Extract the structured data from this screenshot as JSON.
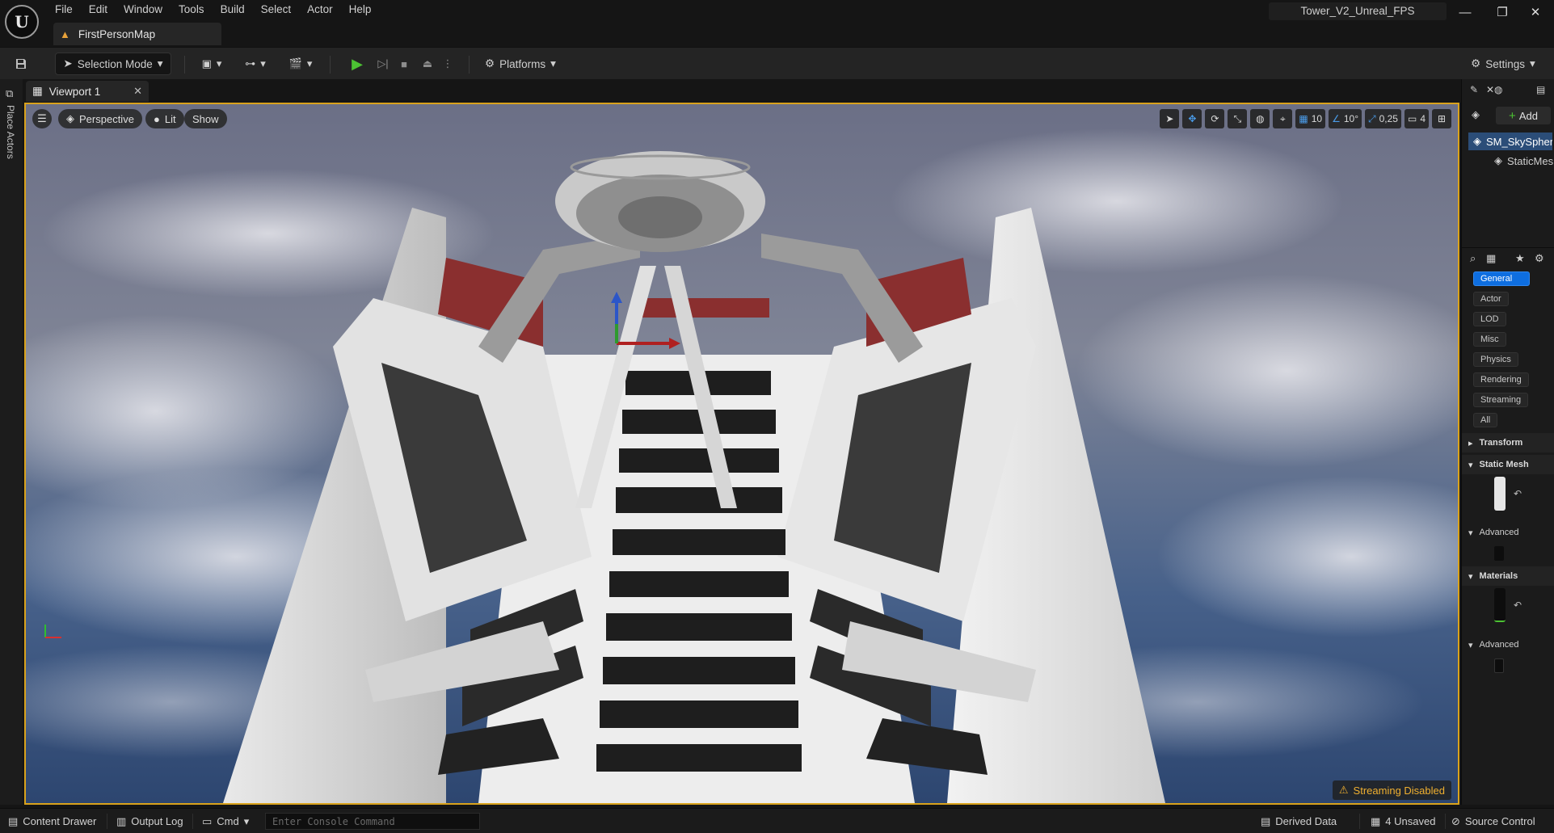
{
  "menu": [
    "File",
    "Edit",
    "Window",
    "Tools",
    "Build",
    "Select",
    "Actor",
    "Help"
  ],
  "map_tab": {
    "label": "FirstPersonMap"
  },
  "project": {
    "name": "Tower_V2_Unreal_FPS"
  },
  "toolbar": {
    "selection_mode": "Selection Mode",
    "platforms": "Platforms",
    "settings": "Settings"
  },
  "left_strip": {
    "place_actors": "Place Actors"
  },
  "viewport": {
    "tab_label": "Viewport 1",
    "perspective": "Perspective",
    "lit": "Lit",
    "show": "Show",
    "grid_snap": "10",
    "rotation_snap": "10°",
    "scale_snap": "0,25",
    "camera_speed": "4",
    "streaming": "Streaming Disabled"
  },
  "right_panel": {
    "add_label": "Add",
    "outliner_selected": "SM_SkySphere",
    "outliner_child": "StaticMeshComponent",
    "categories": [
      "General",
      "Actor",
      "LOD",
      "Misc",
      "Physics",
      "Rendering",
      "Streaming",
      "All"
    ],
    "active_category": "General",
    "sections": {
      "transform": "Transform",
      "static_mesh": "Static Mesh",
      "advanced": "Advanced",
      "materials": "Materials"
    }
  },
  "status_bar": {
    "content_drawer": "Content Drawer",
    "output_log": "Output Log",
    "cmd": "Cmd",
    "console_placeholder": "Enter Console Command",
    "derived_data": "Derived Data",
    "unsaved": "4 Unsaved",
    "source_control": "Source Control"
  },
  "colors": {
    "accent_blue": "#0e6ee0",
    "viewport_border": "#d9a21c",
    "play_green": "#4cc233",
    "warning": "#f0b030"
  }
}
